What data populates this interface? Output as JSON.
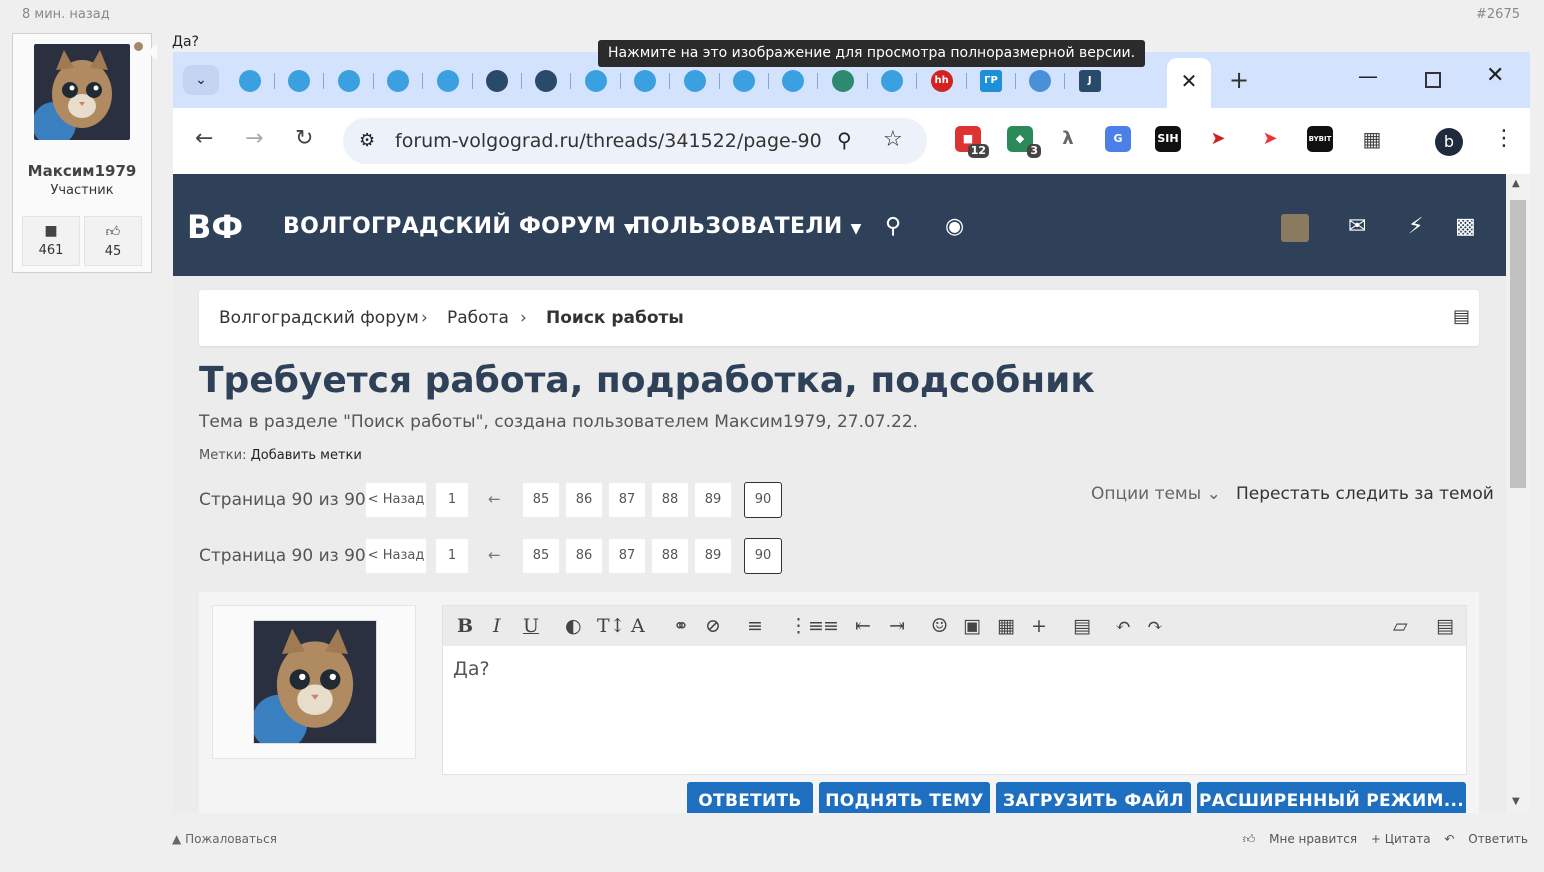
{
  "post": {
    "time": "8 мин. назад",
    "number": "#2675",
    "text": "Да?",
    "user": {
      "name": "Максим1979",
      "role": "Участник",
      "messages": "461",
      "likes": "45"
    },
    "tooltip": "Нажмите на это изображение для просмотра полноразмерной версии.",
    "report": "Пожаловаться",
    "actions": {
      "like": "Мне нравится",
      "quote": "+ Цитата",
      "reply": "Ответить"
    }
  },
  "browser": {
    "active_tab_close": "✕",
    "new_tab": "+",
    "url": "forum-volgograd.ru/threads/341522/page-90",
    "profile_letter": "b",
    "ext_badges": {
      "first": "12",
      "second": "3"
    },
    "ext_labels": {
      "hh": "hh",
      "gr": "ГР",
      "j": "J",
      "sih": "SIH",
      "bybit": "BYBIT"
    }
  },
  "site": {
    "logo": "ВФ",
    "nav": {
      "forum": "ВОЛГОГРАДСКИЙ ФОРУМ",
      "users": "ПОЛЬЗОВАТЕЛИ"
    },
    "breadcrumbs": [
      "Волгоградский форум",
      "Работа",
      "Поиск работы"
    ],
    "title": "Требуется работа, подработка, подсобник",
    "subtitle": "Тема в разделе \"Поиск работы\", создана пользователем Максим1979, 27.07.22.",
    "tags_label": "Метки:",
    "tags_add": "Добавить метки",
    "pager": {
      "label": "Страница 90 из 90",
      "prev": "< Назад",
      "first": "1",
      "gap": "←",
      "pages": [
        "85",
        "86",
        "87",
        "88",
        "89"
      ],
      "current": "90"
    },
    "thread_options": "Опции темы",
    "unwatch": "Перестать следить за темой",
    "editor_text": "Да?",
    "buttons": {
      "reply": "ОТВЕТИТЬ",
      "bump": "ПОДНЯТЬ ТЕМУ",
      "upload": "ЗАГРУЗИТЬ ФАЙЛ",
      "advanced": "РАСШИРЕННЫЙ РЕЖИМ..."
    }
  }
}
